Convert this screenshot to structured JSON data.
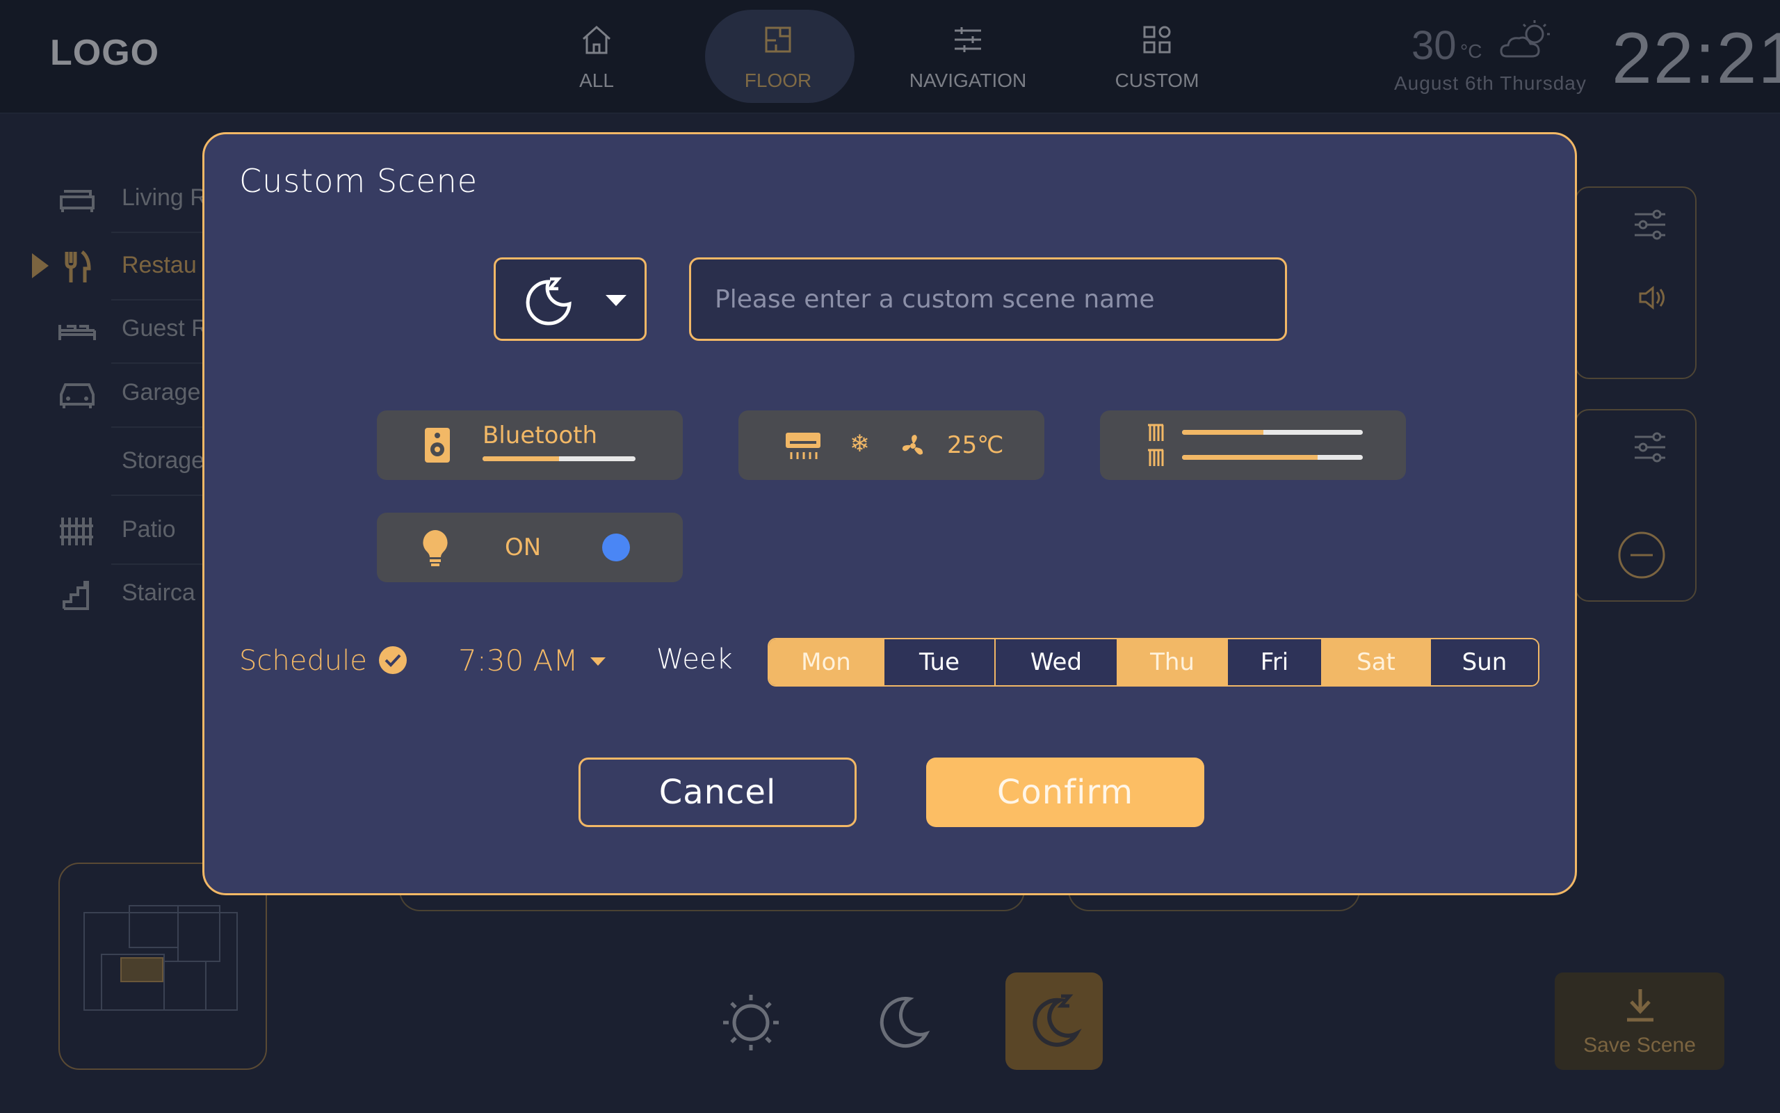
{
  "app": {
    "logo": "LOGO"
  },
  "nav": [
    {
      "label": "ALL",
      "icon": "home-icon",
      "active": false
    },
    {
      "label": "FLOOR",
      "icon": "floor-plan-icon",
      "active": true
    },
    {
      "label": "NAVIGATION",
      "icon": "sliders-icon",
      "active": false
    },
    {
      "label": "CUSTOM",
      "icon": "grid-icon",
      "active": false
    }
  ],
  "weather": {
    "temp": "30",
    "unit": "°C",
    "date": "August  6th  Thursday",
    "icon": "cloudy-sun-icon"
  },
  "clock": "22:21",
  "rooms": [
    {
      "label": "Living R",
      "icon": "sofa-icon"
    },
    {
      "label": "Restau",
      "icon": "utensils-icon",
      "active": true
    },
    {
      "label": "Guest R",
      "icon": "bed-icon"
    },
    {
      "label": "Garage",
      "icon": "car-icon"
    },
    {
      "label": "Storage",
      "icon": ""
    },
    {
      "label": "Patio",
      "icon": "fence-icon"
    },
    {
      "label": "Stairca",
      "icon": "stairs-icon"
    }
  ],
  "save_scene": {
    "label": "Save Scene",
    "icon": "download-icon"
  },
  "bottom_scenes": [
    "sun-icon",
    "moon-icon",
    "sleep-moon-icon"
  ],
  "modal": {
    "title": "Custom Scene",
    "scene_icon": "sleep-moon-icon",
    "name_placeholder": "Please enter a custom scene name",
    "name_value": "",
    "bluetooth": {
      "label": "Bluetooth",
      "volume": 0.5,
      "icon": "speaker-icon"
    },
    "ac": {
      "temperature": "25℃",
      "mode_icon": "snowflake-icon",
      "fan_icon": "fan-icon",
      "icon": "air-conditioner-icon"
    },
    "curtains": {
      "curtain_1": 0.45,
      "curtain_2": 0.75,
      "icon": "curtain-icon"
    },
    "light": {
      "state": "ON",
      "icon": "bulb-icon",
      "toggle_color": "#4a86f5"
    },
    "schedule": {
      "label": "Schedule",
      "enabled": true,
      "time": "7:30  AM",
      "week_label": "Week",
      "days": [
        {
          "label": "Mon",
          "selected": true
        },
        {
          "label": "Tue",
          "selected": false
        },
        {
          "label": "Wed",
          "selected": false
        },
        {
          "label": "Thu",
          "selected": true
        },
        {
          "label": "Fri",
          "selected": false
        },
        {
          "label": "Sat",
          "selected": true
        },
        {
          "label": "Sun",
          "selected": false
        }
      ]
    },
    "cancel_label": "Cancel",
    "confirm_label": "Confirm"
  },
  "colors": {
    "accent": "#f2b866",
    "modal_bg": "#373c62",
    "app_bg": "#1b2030"
  }
}
